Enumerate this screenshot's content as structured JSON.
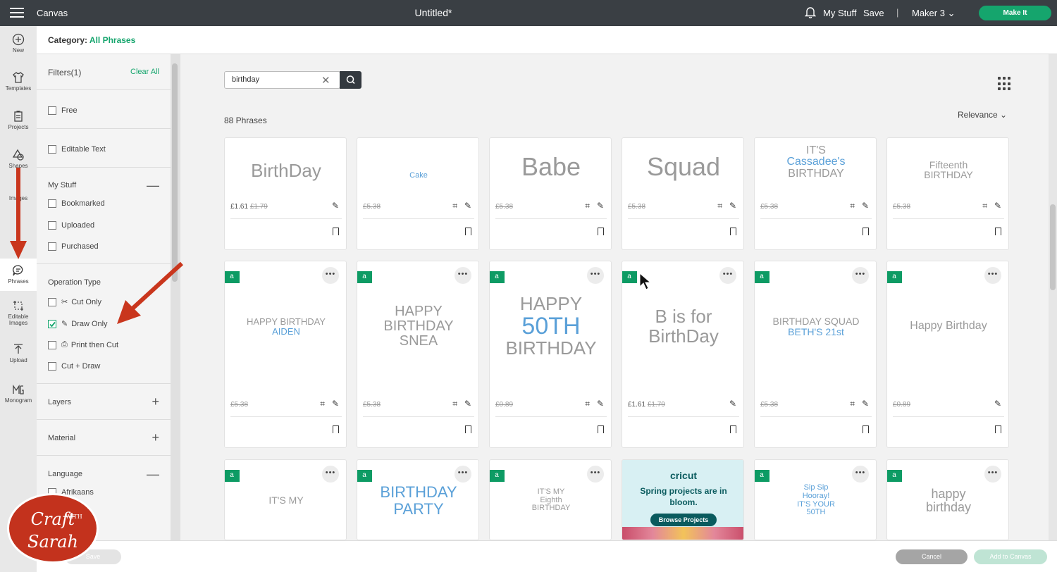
{
  "topbar": {
    "app_title": "Canvas",
    "doc_title": "Untitled*",
    "my_stuff": "My Stuff",
    "save": "Save",
    "separator": "|",
    "machine": "Maker 3",
    "make_it": "Make It"
  },
  "leftnav": {
    "items": [
      {
        "label": "New",
        "icon": "plus-circle-icon"
      },
      {
        "label": "Templates",
        "icon": "shirt-icon"
      },
      {
        "label": "Projects",
        "icon": "projects-icon"
      },
      {
        "label": "Shapes",
        "icon": "shapes-icon"
      },
      {
        "label": "Images",
        "icon": "images-icon"
      },
      {
        "label": "Phrases",
        "icon": "phrases-icon"
      },
      {
        "label": "Editable Images",
        "icon": "editable-images-icon"
      },
      {
        "label": "Upload",
        "icon": "upload-icon"
      },
      {
        "label": "Monogram",
        "icon": "monogram-icon"
      }
    ]
  },
  "category": {
    "prefix": "Category:",
    "value": "All Phrases"
  },
  "filters": {
    "title": "Filters(1)",
    "clear_all": "Clear All",
    "free": "Free",
    "editable_text": "Editable Text",
    "my_stuff": {
      "title": "My Stuff",
      "sign": "—",
      "items": [
        "Bookmarked",
        "Uploaded",
        "Purchased"
      ]
    },
    "operation_type": {
      "title": "Operation Type",
      "items": [
        "Cut Only",
        "Draw Only",
        "Print then Cut",
        "Cut + Draw"
      ],
      "checked": "Draw Only"
    },
    "layers": {
      "title": "Layers",
      "sign": "+"
    },
    "material": {
      "title": "Material",
      "sign": "+"
    },
    "language": {
      "title": "Language",
      "sign": "—",
      "items": [
        "Afrikaans"
      ]
    }
  },
  "search": {
    "value": "birthday",
    "placeholder": "Search"
  },
  "results": {
    "count": "88 Phrases",
    "sort": "Relevance"
  },
  "rows": [
    {
      "cards": [
        {
          "art": [
            "BirthDay"
          ],
          "price": "£1.61",
          "old": "£1.79",
          "attach": false
        },
        {
          "art": [
            "Cake"
          ],
          "price": "",
          "old": "£5.38",
          "attach": true
        },
        {
          "art": [
            "Babe"
          ],
          "price": "",
          "old": "£5.38",
          "attach": true
        },
        {
          "art": [
            "Squad"
          ],
          "price": "",
          "old": "£5.38",
          "attach": true
        },
        {
          "art": [
            "IT'S",
            "Cassadee's",
            "BIRTHDAY"
          ],
          "price": "",
          "old": "£5.38",
          "attach": true
        },
        {
          "art": [
            "Fifteenth",
            "BIRTHDAY"
          ],
          "price": "",
          "old": "£5.38",
          "attach": true
        }
      ]
    },
    {
      "cards": [
        {
          "art": [
            "HAPPY BIRTHDAY",
            "AIDEN"
          ],
          "price": "",
          "old": "£5.38",
          "attach": true
        },
        {
          "art": [
            "HAPPY",
            "BIRTHDAY",
            "SNEA"
          ],
          "price": "",
          "old": "£5.38",
          "attach": true
        },
        {
          "art": [
            "HAPPY",
            "50TH",
            "BIRTHDAY"
          ],
          "price": "",
          "old": "£0.89",
          "attach": true
        },
        {
          "art": [
            "B is for",
            "BirthDay"
          ],
          "price": "£1.61",
          "old": "£1.79",
          "attach": false
        },
        {
          "art": [
            "BIRTHDAY SQUAD",
            "BETH'S 21st"
          ],
          "price": "",
          "old": "£5.38",
          "attach": true
        },
        {
          "art": [
            "Happy Birthday"
          ],
          "price": "",
          "old": "£0.89",
          "attach": false
        }
      ]
    },
    {
      "cards": [
        {
          "art": [
            "IT'S MY"
          ]
        },
        {
          "art": [
            "BIRTHDAY",
            "PARTY"
          ]
        },
        {
          "art": [
            "IT'S MY",
            "Eighth",
            "BIRTHDAY"
          ]
        },
        {
          "ad": true,
          "brand": "cricut",
          "text": "Spring projects are in bloom.",
          "cta": "Browse Projects"
        },
        {
          "art": [
            "Sip Sip",
            "Hooray!",
            "IT'S YOUR",
            "50TH"
          ]
        },
        {
          "art": [
            "happy",
            "birthday"
          ]
        }
      ]
    }
  ],
  "flag_label": "a",
  "more_label": "•••",
  "footer": {
    "cancel": "Cancel",
    "add_to_canvas": "Add to Canvas",
    "save": "Save"
  },
  "watermark": {
    "line1": "Craft",
    "with": "WITH",
    "line2": "Sarah"
  },
  "colors": {
    "accent": "#15a56d",
    "topbar": "#3a3f44",
    "arrow": "#c9361d"
  }
}
